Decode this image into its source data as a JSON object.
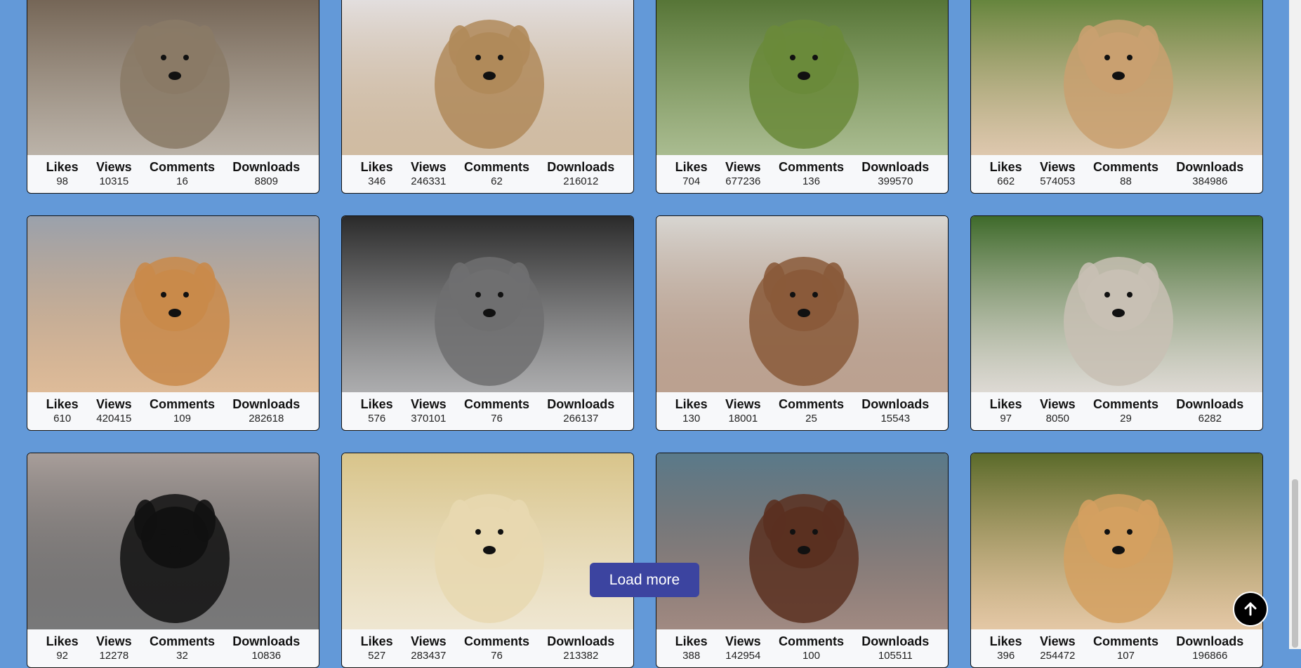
{
  "labels": {
    "likes": "Likes",
    "views": "Views",
    "comments": "Comments",
    "downloads": "Downloads",
    "load_more": "Load more"
  },
  "cards": [
    {
      "likes": "98",
      "views": "10315",
      "comments": "16",
      "downloads": "8809",
      "palette": [
        "#6a5a4a",
        "#8a7a66"
      ]
    },
    {
      "likes": "346",
      "views": "246331",
      "comments": "62",
      "downloads": "216012",
      "palette": [
        "#e8e8ee",
        "#b08a5a"
      ]
    },
    {
      "likes": "704",
      "views": "677236",
      "comments": "136",
      "downloads": "399570",
      "palette": [
        "#4a6a2a",
        "#6a8a3a"
      ]
    },
    {
      "likes": "662",
      "views": "574053",
      "comments": "88",
      "downloads": "384986",
      "palette": [
        "#4f7a2a",
        "#c9a070"
      ]
    },
    {
      "likes": "610",
      "views": "420415",
      "comments": "109",
      "downloads": "282618",
      "palette": [
        "#9aa1ac",
        "#c98a4a"
      ]
    },
    {
      "likes": "576",
      "views": "370101",
      "comments": "76",
      "downloads": "266137",
      "palette": [
        "#2a2a2a",
        "#6f6f70"
      ]
    },
    {
      "likes": "130",
      "views": "18001",
      "comments": "25",
      "downloads": "15543",
      "palette": [
        "#d8d6d2",
        "#8a5a3a"
      ]
    },
    {
      "likes": "97",
      "views": "8050",
      "comments": "29",
      "downloads": "6282",
      "palette": [
        "#3e6a2a",
        "#c8c0b4"
      ]
    },
    {
      "likes": "92",
      "views": "12278",
      "comments": "32",
      "downloads": "10836",
      "palette": [
        "#a89e9a",
        "#111111"
      ]
    },
    {
      "likes": "527",
      "views": "283437",
      "comments": "76",
      "downloads": "213382",
      "palette": [
        "#d8c48a",
        "#e8d8b0"
      ]
    },
    {
      "likes": "388",
      "views": "142954",
      "comments": "100",
      "downloads": "105511",
      "palette": [
        "#5a7a8a",
        "#5a3020"
      ]
    },
    {
      "likes": "396",
      "views": "254472",
      "comments": "107",
      "downloads": "196866",
      "palette": [
        "#5a6a2a",
        "#d4a060"
      ]
    }
  ],
  "icons": {
    "back_to_top": "arrow-up-icon"
  },
  "colors": {
    "page_bg": "#6399d8",
    "button_bg": "#3c44a0",
    "card_bg": "#f7f8fa"
  }
}
